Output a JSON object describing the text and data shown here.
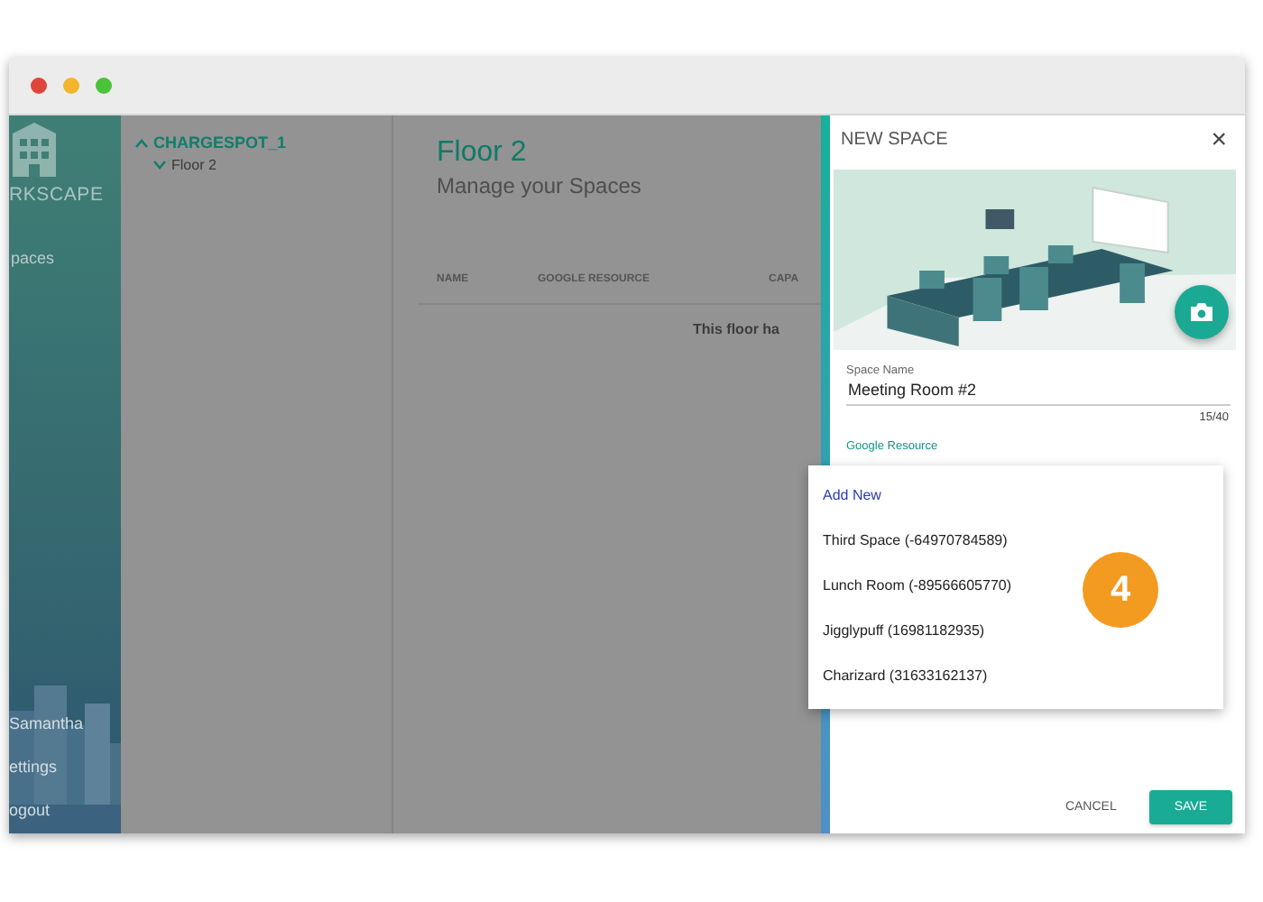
{
  "sidebar": {
    "logo_text": "RKSCAPE",
    "items": [
      {
        "label": "paces"
      }
    ],
    "footer_items": [
      {
        "label": "Samantha"
      },
      {
        "label": "ettings"
      },
      {
        "label": "ogout"
      }
    ]
  },
  "tree": [
    {
      "label": "CHARGESPOT_1",
      "expanded": true,
      "children": [
        {
          "label": "Floor 2",
          "expanded": false
        }
      ]
    }
  ],
  "main": {
    "title": "Floor 2",
    "subtitle": "Manage your Spaces",
    "table": {
      "columns": [
        "NAME",
        "GOOGLE RESOURCE",
        "CAPA"
      ],
      "empty_message": "This floor ha"
    }
  },
  "drawer": {
    "title": "NEW SPACE",
    "close": "×",
    "fields": [
      {
        "label": "Space Name",
        "value": "Meeting Room #2",
        "counter": "15/40"
      },
      {
        "label": "Google Resource"
      }
    ],
    "menu": [
      {
        "kind": "action",
        "label": "Add New"
      },
      {
        "kind": "option",
        "label": "Third Space (-64970784589)"
      },
      {
        "kind": "option",
        "label": "Lunch Room (-89566605770)"
      },
      {
        "kind": "option",
        "label": "Jigglypuff (16981182935)"
      },
      {
        "kind": "option",
        "label": "Charizard (31633162137)"
      }
    ],
    "buttons": [
      {
        "kind": "text",
        "label": "CANCEL"
      },
      {
        "kind": "primary",
        "label": "SAVE"
      }
    ]
  },
  "step_badge": "4"
}
